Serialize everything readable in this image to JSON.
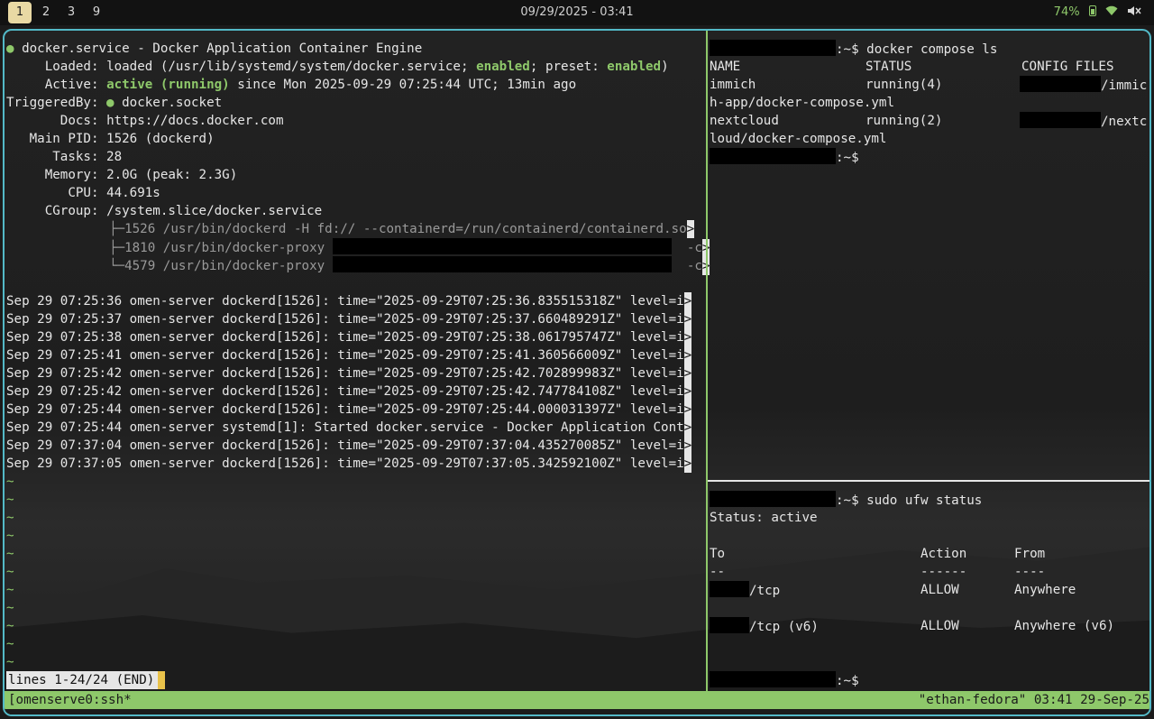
{
  "topbar": {
    "workspaces": [
      "1",
      "2",
      "3",
      "9"
    ],
    "clock": "09/29/2025 - 03:41",
    "battery": "74%"
  },
  "left": {
    "status": [
      {
        "label": "",
        "value": "docker.service - Docker Application Container Engine"
      },
      {
        "label": "Loaded:",
        "value_pre": "loaded (/usr/lib/systemd/system/docker.service; ",
        "enabled1": "enabled",
        "mid": "; preset: ",
        "enabled2": "enabled",
        "post": ")"
      },
      {
        "label": "Active:",
        "active": "active (running)",
        "rest": " since Mon 2025-09-29 07:25:44 UTC; 13min ago"
      },
      {
        "label": "TriggeredBy:",
        "value": "docker.socket"
      },
      {
        "label": "Docs:",
        "value": "https://docs.docker.com"
      },
      {
        "label": "Main PID:",
        "value": "1526 (dockerd)"
      },
      {
        "label": "Tasks:",
        "value": "28"
      },
      {
        "label": "Memory:",
        "value": "2.0G (peak: 2.3G)"
      },
      {
        "label": "CPU:",
        "value": "44.691s"
      },
      {
        "label": "CGroup:",
        "value": "/system.slice/docker.service"
      }
    ],
    "cgroup": [
      "├─1526 /usr/bin/dockerd -H fd:// --containerd=/run/containerd/containerd.so",
      "├─1810 /usr/bin/docker-proxy ",
      "└─4579 /usr/bin/docker-proxy "
    ],
    "cgroup_suffix": "-c",
    "logs": [
      "Sep 29 07:25:36 omen-server dockerd[1526]: time=\"2025-09-29T07:25:36.835515318Z\" level=i",
      "Sep 29 07:25:37 omen-server dockerd[1526]: time=\"2025-09-29T07:25:37.660489291Z\" level=i",
      "Sep 29 07:25:38 omen-server dockerd[1526]: time=\"2025-09-29T07:25:38.061795747Z\" level=i",
      "Sep 29 07:25:41 omen-server dockerd[1526]: time=\"2025-09-29T07:25:41.360566009Z\" level=i",
      "Sep 29 07:25:42 omen-server dockerd[1526]: time=\"2025-09-29T07:25:42.702899983Z\" level=i",
      "Sep 29 07:25:42 omen-server dockerd[1526]: time=\"2025-09-29T07:25:42.747784108Z\" level=i",
      "Sep 29 07:25:44 omen-server dockerd[1526]: time=\"2025-09-29T07:25:44.000031397Z\" level=i",
      "Sep 29 07:25:44 omen-server systemd[1]: Started docker.service - Docker Application Cont",
      "Sep 29 07:37:04 omen-server dockerd[1526]: time=\"2025-09-29T07:37:04.435270085Z\" level=i",
      "Sep 29 07:37:05 omen-server dockerd[1526]: time=\"2025-09-29T07:37:05.342592100Z\" level=i"
    ],
    "tilde": "~",
    "truncation_marker": ">",
    "pager": "lines 1-24/24 (END)"
  },
  "right_top": {
    "prompt_suffix": ":~$",
    "command": " docker compose ls",
    "headers": [
      "NAME",
      "STATUS",
      "CONFIG FILES"
    ],
    "rows": [
      {
        "name": "immich",
        "status": "running(4)",
        "config_tail": "/immic",
        "wrap": "h-app/docker-compose.yml"
      },
      {
        "name": "nextcloud",
        "status": "running(2)",
        "config_tail": "/nextc",
        "wrap": "loud/docker-compose.yml"
      }
    ]
  },
  "right_bottom": {
    "prompt_suffix": ":~$",
    "command": " sudo ufw status",
    "status_line": "Status: active",
    "headers": [
      "To",
      "Action",
      "From"
    ],
    "dashes": [
      "--",
      "------",
      "----"
    ],
    "rows": [
      {
        "to": "/tcp",
        "action": "ALLOW",
        "from": "Anywhere"
      },
      {
        "to": "/tcp (v6)",
        "action": "ALLOW",
        "from": "Anywhere (v6)"
      }
    ]
  },
  "tmux": {
    "left": "[omenserve0:ssh*",
    "right": "\"ethan-fedora\" 03:41 29-Sep-25"
  },
  "colors": {
    "accent_green": "#8ec86a",
    "frame_border": "#53b9c7"
  }
}
